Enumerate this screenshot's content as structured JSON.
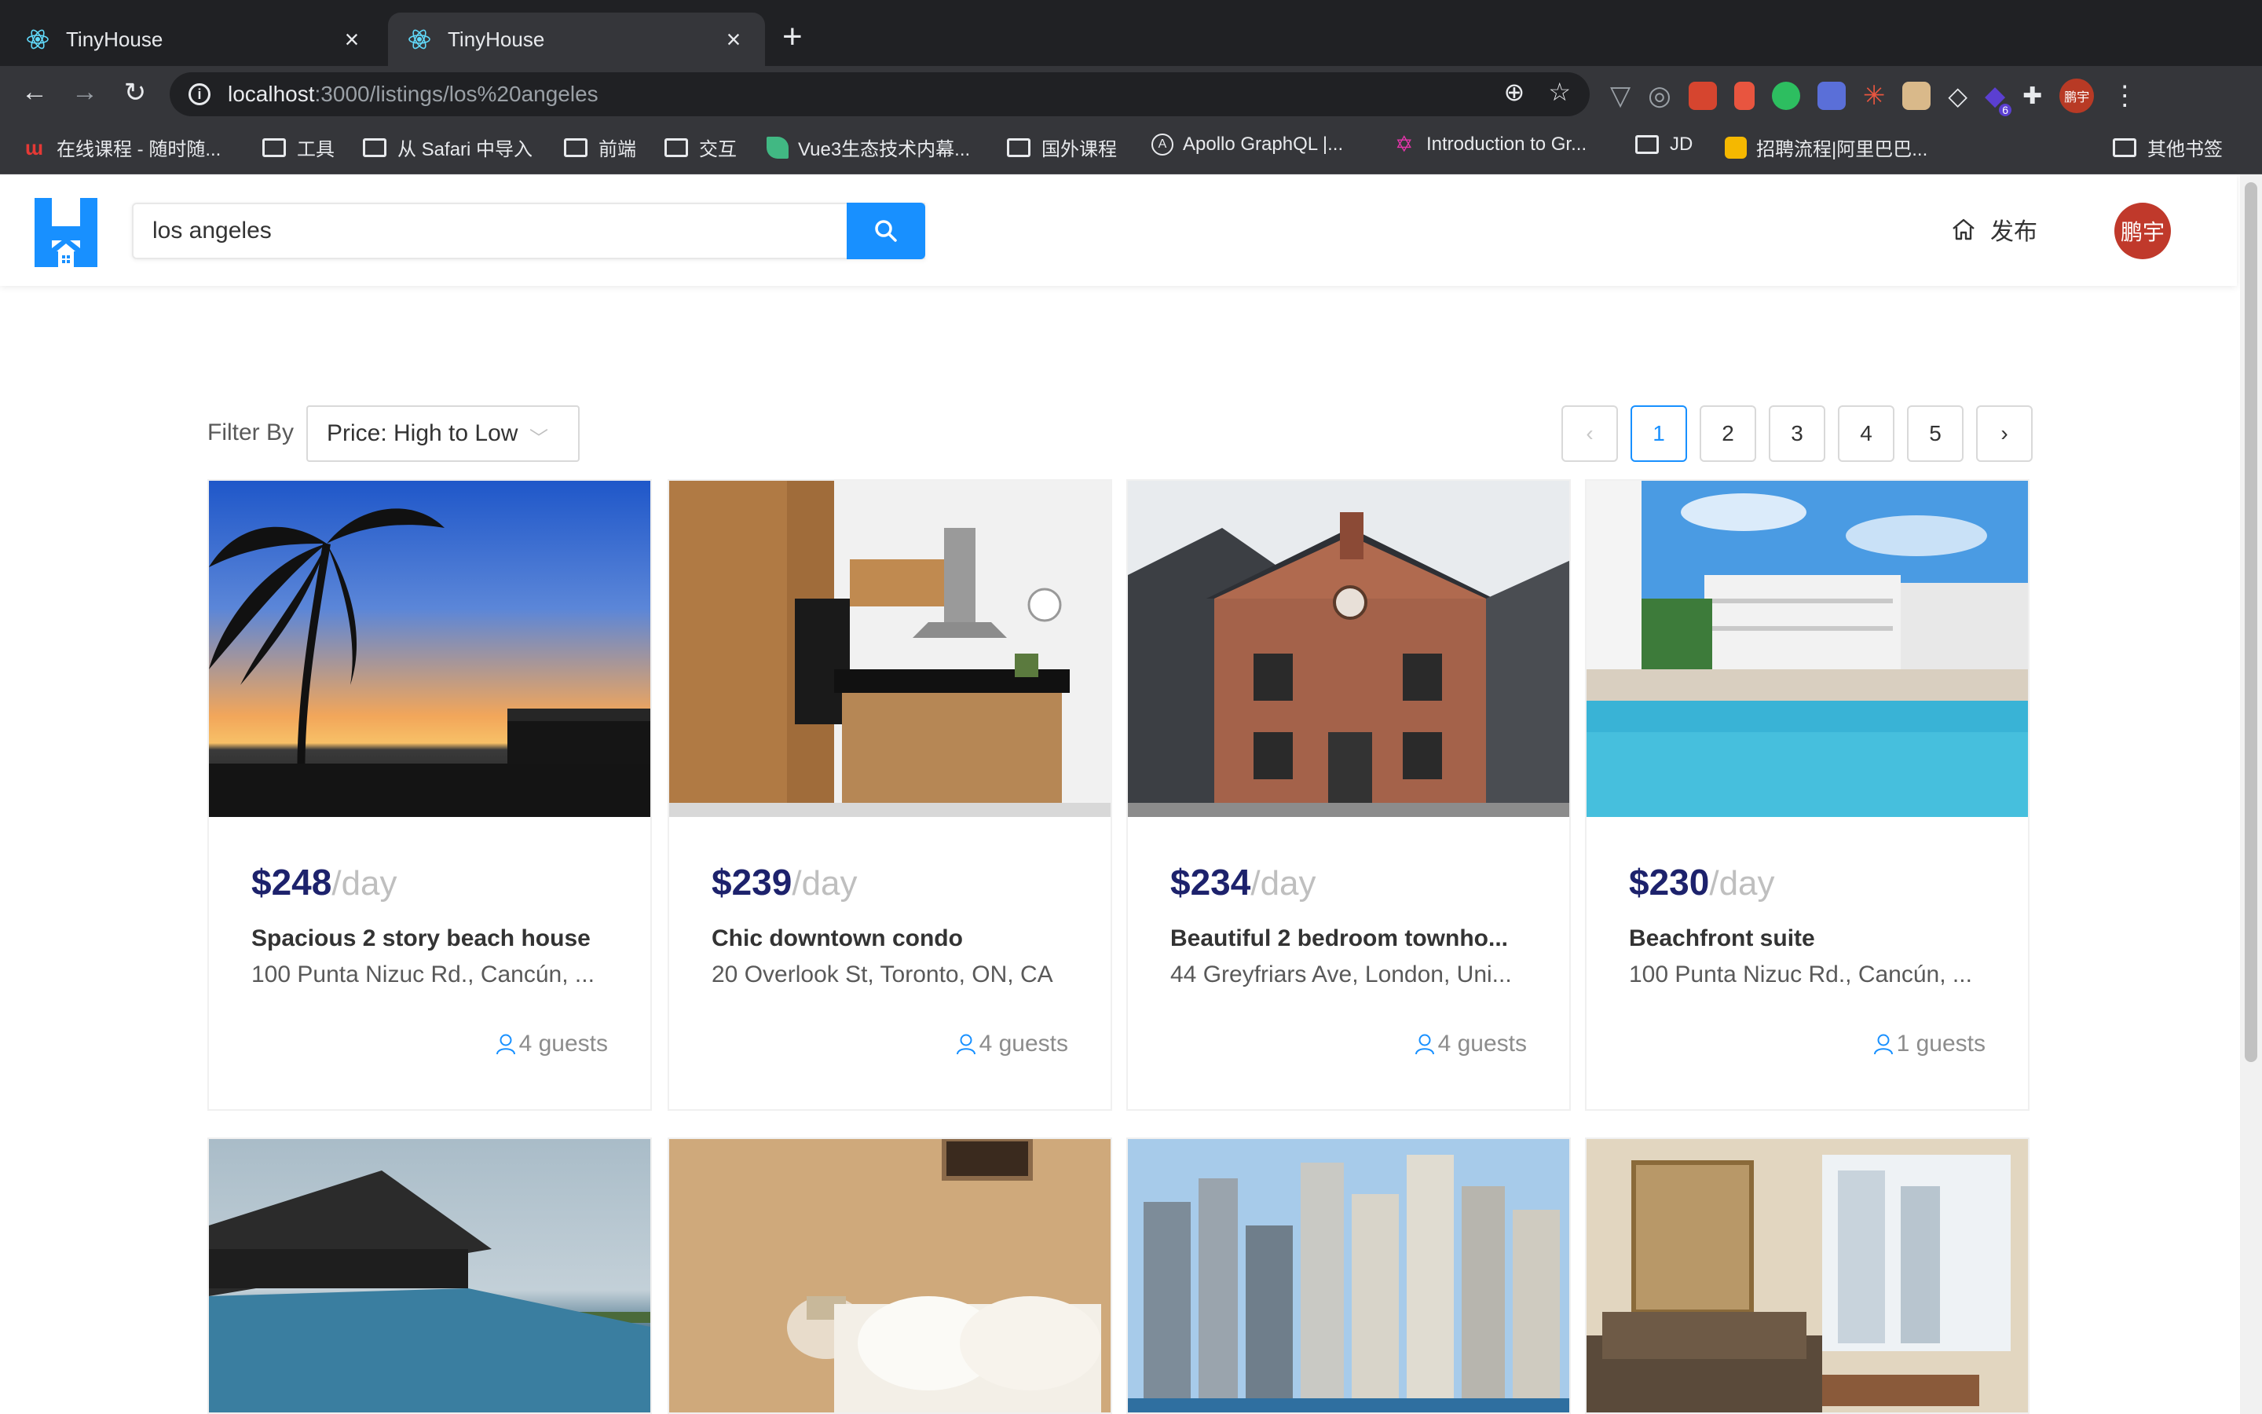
{
  "browser": {
    "tabs": [
      {
        "title": "TinyHouse",
        "active": false
      },
      {
        "title": "TinyHouse",
        "active": true
      }
    ],
    "url_host": "localhost",
    "url_rest": ":3000/listings/los%20angeles",
    "bookmarks": [
      {
        "label": "在线课程 - 随时随...",
        "icon": "coursera-favicon"
      },
      {
        "label": "工具",
        "icon": "folder-icon"
      },
      {
        "label": "从 Safari 中导入",
        "icon": "folder-icon"
      },
      {
        "label": "前端",
        "icon": "folder-icon"
      },
      {
        "label": "交互",
        "icon": "folder-icon"
      },
      {
        "label": "Vue3生态技术内幕...",
        "icon": "leaf-favicon"
      },
      {
        "label": "国外课程",
        "icon": "folder-icon"
      },
      {
        "label": "Apollo GraphQL |...",
        "icon": "apollo-favicon"
      },
      {
        "label": "Introduction to Gr...",
        "icon": "graphql-favicon"
      },
      {
        "label": "JD",
        "icon": "folder-icon"
      },
      {
        "label": "招聘流程|阿里巴巴...",
        "icon": "alibaba-favicon"
      },
      {
        "label": "其他书签",
        "icon": "folder-icon"
      }
    ],
    "profile_badge": "鹏宇",
    "ext_badge": "6"
  },
  "header": {
    "search_value": "los angeles",
    "publish_label": "发布",
    "avatar_text": "鹏宇"
  },
  "filter": {
    "label": "Filter By",
    "selected": "Price: High to Low"
  },
  "pagination": {
    "pages": [
      "1",
      "2",
      "3",
      "4",
      "5"
    ],
    "current": "1"
  },
  "listings": [
    {
      "price": "$248",
      "per": "/day",
      "title": "Spacious 2 story beach house",
      "address": "100 Punta Nizuc Rd., Cancún, ...",
      "guests": "4 guests"
    },
    {
      "price": "$239",
      "per": "/day",
      "title": "Chic downtown condo",
      "address": "20 Overlook St, Toronto, ON, CA",
      "guests": "4 guests"
    },
    {
      "price": "$234",
      "per": "/day",
      "title": "Beautiful 2 bedroom townho...",
      "address": "44 Greyfriars Ave, London, Uni...",
      "guests": "4 guests"
    },
    {
      "price": "$230",
      "per": "/day",
      "title": "Beachfront suite",
      "address": "100 Punta Nizuc Rd., Cancún, ...",
      "guests": "1 guests"
    }
  ],
  "colors": {
    "primary": "#1890ff",
    "price": "#1d226c",
    "avatar": "#c0392b"
  }
}
